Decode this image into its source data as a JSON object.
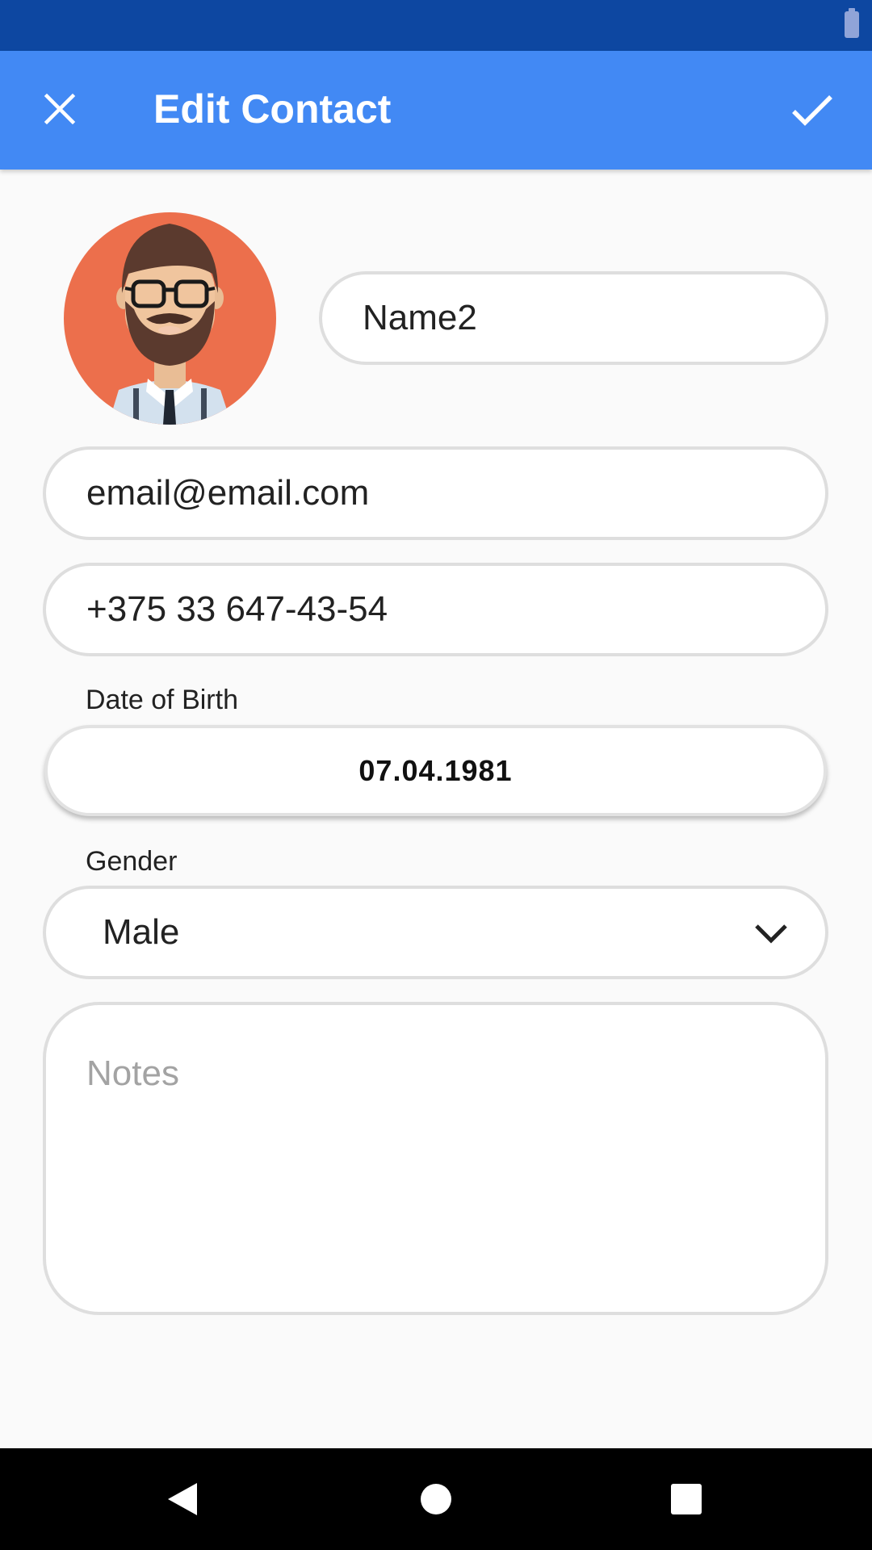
{
  "app_bar": {
    "title": "Edit Contact",
    "close_icon": "close-icon",
    "confirm_icon": "check-icon",
    "color": "#4289f4"
  },
  "status_bar": {
    "color": "#0d47a1",
    "icons": [
      "battery-icon"
    ]
  },
  "contact": {
    "avatar": "avatar-bearded-man",
    "name": "Name2",
    "email": "email@email.com",
    "phone": "+375 33 647-43-54",
    "dob_label": "Date of Birth",
    "dob": "07.04.1981",
    "gender_label": "Gender",
    "gender": "Male",
    "notes_placeholder": "Notes"
  },
  "nav_bar": {
    "icons": [
      "back-icon",
      "home-icon",
      "recents-icon"
    ]
  }
}
